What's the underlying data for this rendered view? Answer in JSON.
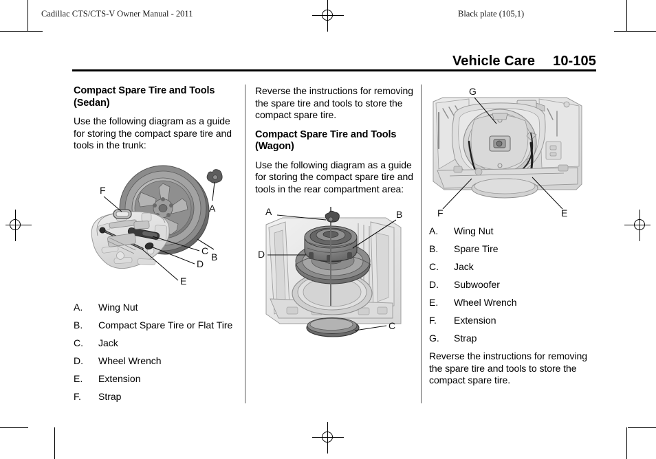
{
  "page": {
    "running_head_left": "Cadillac CTS/CTS-V Owner Manual - 2011",
    "running_head_right": "Black plate (105,1)",
    "chapter_title": "Vehicle Care",
    "page_number": "10-105"
  },
  "column1": {
    "section_title": "Compact Spare Tire and Tools (Sedan)",
    "intro": "Use the following diagram as a guide for storing the compact spare tire and tools in the trunk:",
    "figure": {
      "name": "sedan-spare-tire-diagram",
      "callouts": [
        "A",
        "B",
        "C",
        "D",
        "E",
        "F"
      ]
    },
    "legend": [
      {
        "key": "A.",
        "value": "Wing Nut"
      },
      {
        "key": "B.",
        "value": "Compact Spare Tire or Flat Tire"
      },
      {
        "key": "C.",
        "value": "Jack"
      },
      {
        "key": "D.",
        "value": "Wheel Wrench"
      },
      {
        "key": "E.",
        "value": "Extension"
      },
      {
        "key": "F.",
        "value": "Strap"
      }
    ]
  },
  "column2": {
    "continued_text": "Reverse the instructions for removing the spare tire and tools to store the compact spare tire.",
    "section_title": "Compact Spare Tire and Tools (Wagon)",
    "intro": "Use the following diagram as a guide for storing the compact spare tire and tools in the rear compartment area:",
    "figure": {
      "name": "wagon-spare-tire-exploded-diagram",
      "callouts": [
        "A",
        "B",
        "C",
        "D"
      ]
    }
  },
  "column3": {
    "figure": {
      "name": "wagon-rear-compartment-diagram",
      "callouts": [
        "E",
        "F",
        "G"
      ]
    },
    "legend": [
      {
        "key": "A.",
        "value": "Wing Nut"
      },
      {
        "key": "B.",
        "value": "Spare Tire"
      },
      {
        "key": "C.",
        "value": "Jack"
      },
      {
        "key": "D.",
        "value": "Subwoofer"
      },
      {
        "key": "E.",
        "value": "Wheel Wrench"
      },
      {
        "key": "F.",
        "value": "Extension"
      },
      {
        "key": "G.",
        "value": "Strap"
      }
    ],
    "closing_text": "Reverse the instructions for removing the spare tire and tools to store the compact spare tire."
  }
}
